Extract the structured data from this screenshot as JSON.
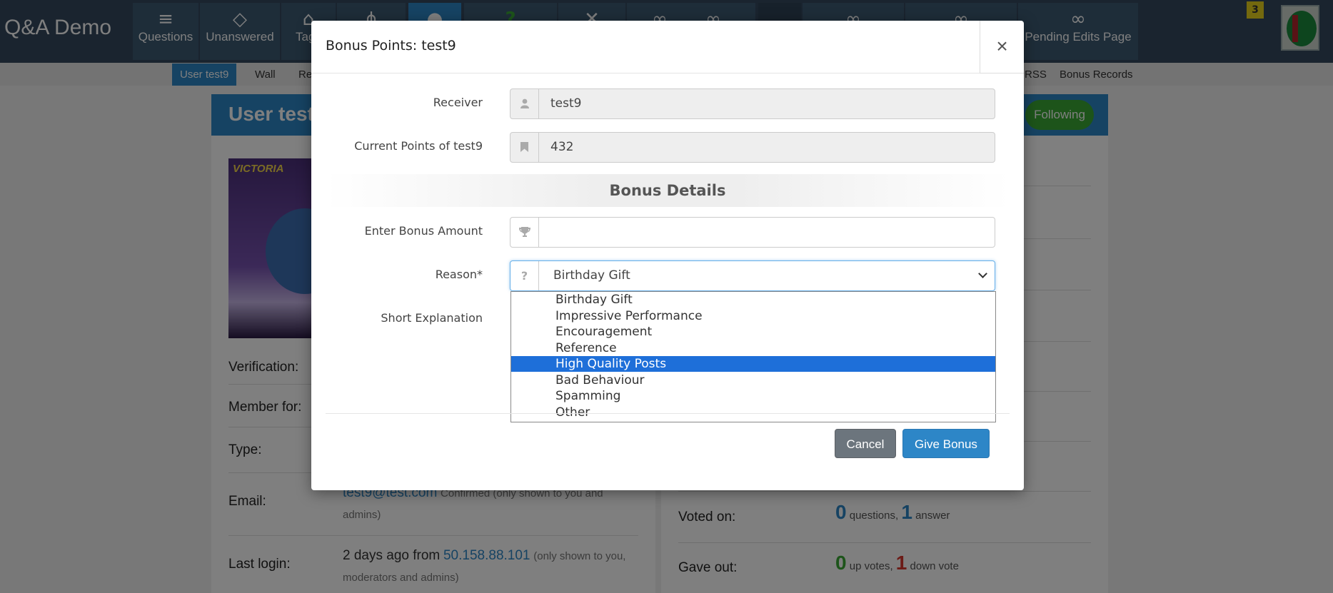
{
  "site": {
    "title": "Q&A Demo",
    "notifications": "3"
  },
  "nav": [
    {
      "label": "Questions",
      "icon": "list-icon"
    },
    {
      "label": "Unanswered",
      "icon": "square-outline-icon"
    },
    {
      "label": "Tags",
      "icon": "tag-icon"
    },
    {
      "label": "",
      "icon": "network-icon"
    },
    {
      "label": "",
      "icon": "users-icon"
    },
    {
      "label": "",
      "icon": "question-icon"
    },
    {
      "label": "",
      "icon": "tools-icon"
    },
    {
      "label": "",
      "icon": "infinity-icon"
    },
    {
      "label": "",
      "icon": "infinity-icon"
    },
    {
      "label": "",
      "icon": "blank"
    },
    {
      "label": "",
      "icon": "infinity-icon"
    },
    {
      "label": "",
      "icon": "infinity-icon"
    },
    {
      "label": "Pending Edits Page",
      "icon": "infinity-icon"
    }
  ],
  "subnav": [
    {
      "label": "User test9",
      "active": true
    },
    {
      "label": "Wall"
    },
    {
      "label": "Re"
    },
    {
      "label": "RSS"
    },
    {
      "label": "Bonus Records"
    }
  ],
  "user_header": {
    "title": "User test",
    "follow_label": "Following"
  },
  "profile": {
    "image_text": "VICTORIA",
    "labels": {
      "verification": "Verification:",
      "member_for": "Member for:",
      "type": "Type:",
      "email": "Email:",
      "last_login": "Last login:"
    },
    "email": {
      "address": "test9@test.com",
      "note": "Confirmed (only shown to you and admins)"
    },
    "last_login": {
      "prefix": "2 days ago from",
      "ip": "50.158.88.101",
      "note": "(only shown to you, moderators and admins)"
    }
  },
  "stats": {
    "voted_on": {
      "label": "Voted on:",
      "questions_count": "0",
      "questions_word": "questions,",
      "answers_count": "1",
      "answers_word": "answer"
    },
    "gave_out": {
      "label": "Gave out:",
      "up_count": "0",
      "up_word": "up votes,",
      "down_count": "1",
      "down_word": "down vote"
    }
  },
  "modal": {
    "title": "Bonus Points: test9",
    "close_symbol": "×",
    "receiver": {
      "label": "Receiver",
      "value": "test9",
      "icon": "user-icon"
    },
    "current_points": {
      "label": "Current Points of test9",
      "value": "432",
      "icon": "bookmark-icon"
    },
    "section_title": "Bonus Details",
    "bonus_amount": {
      "label": "Enter Bonus Amount",
      "value": "",
      "icon": "trophy-icon"
    },
    "reason": {
      "label": "Reason*",
      "icon": "question-icon",
      "selected": "Birthday Gift",
      "options": [
        "Birthday Gift",
        "Impressive Performance",
        "Encouragement",
        "Reference",
        "High Quality Posts",
        "Bad Behaviour",
        "Spamming",
        "Other"
      ],
      "highlighted": "High Quality Posts"
    },
    "short_explanation": {
      "label": "Short Explanation"
    },
    "buttons": {
      "cancel": "Cancel",
      "give": "Give Bonus"
    }
  },
  "colors": {
    "topbar": "#34495e",
    "accent": "#2d86c7",
    "follow": "#3aa935",
    "highlight": "#1e6fd9",
    "down": "#d9362c"
  }
}
